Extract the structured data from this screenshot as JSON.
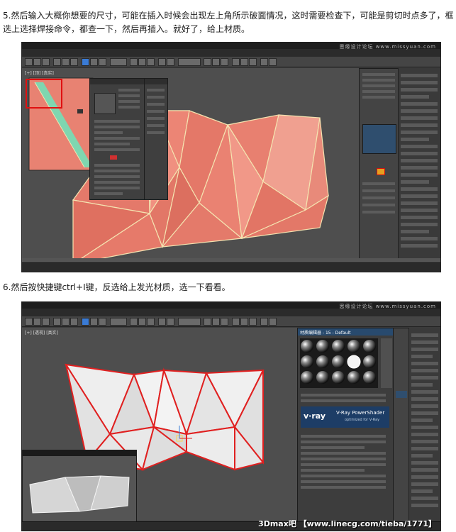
{
  "paragraph1": "5.然后输入大概你想要的尺寸，可能在插入时候会出现左上角所示破面情况，这时需要检查下，可能是剪切时点多了，框选上选择焊接命令，都查一下，然后再插入。就好了，给上材质。",
  "paragraph2": "6.然后按快捷键ctrl+I键，反选给上发光材质，选一下看看。",
  "screenshot1": {
    "brand": "思缘设计论坛 www.missyuan.com",
    "viewport_label": "[+] [顶] [真实]"
  },
  "screenshot2": {
    "brand": "思缘设计论坛 www.missyuan.com",
    "viewport_label": "[+] [透视] [真实]",
    "material_editor_title": "材质编辑器 - 15 - Default",
    "vray_logo": "v·ray",
    "vray_title": "V-Ray PowerShader",
    "vray_subtitle": "optimized for V-Ray",
    "watermark": "3Dmax吧 【www.linecg.com/tieba/1771】"
  },
  "colors": {
    "mesh_fill": "#e88272",
    "mesh_edge": "#f4e3b0",
    "selected_edge": "#e02020",
    "light_mesh": "#e6e6e6",
    "highlight_box": "#e01010",
    "ui_dark": "#3b3b3b"
  }
}
